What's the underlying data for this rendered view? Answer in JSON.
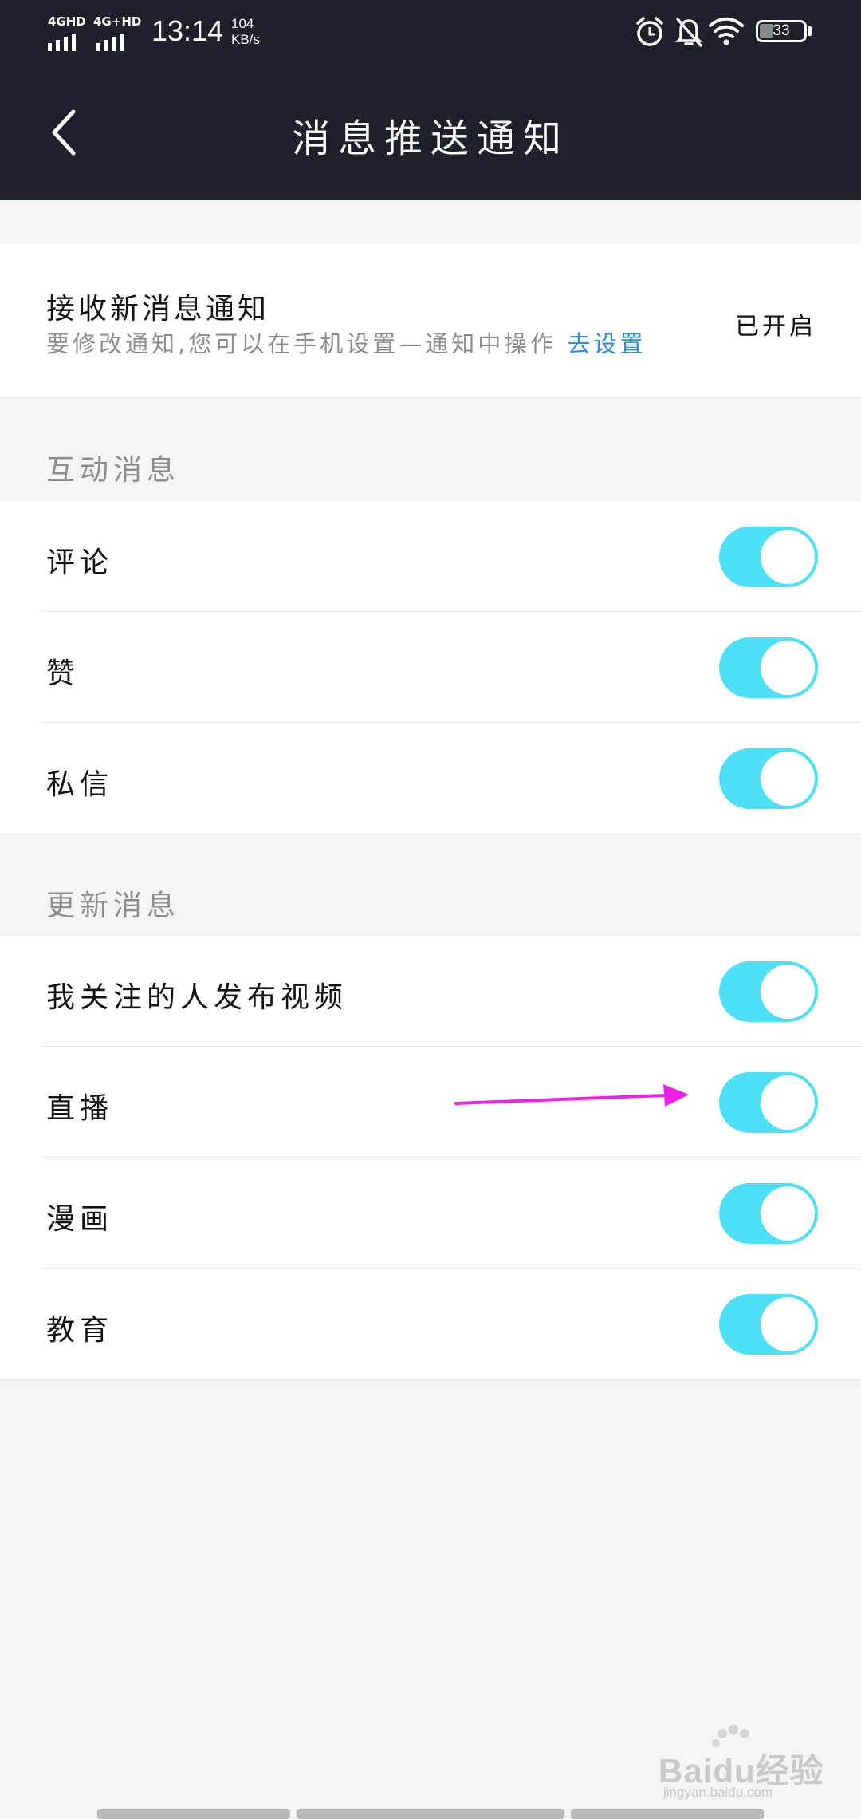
{
  "status_bar": {
    "signal1": "4GHD",
    "signal2": "4G+HD",
    "time": "13:14",
    "speed_value": "104",
    "speed_unit": "KB/s",
    "battery": "33",
    "icons": [
      "alarm-icon",
      "mute-bell-icon",
      "wifi-icon",
      "battery-icon"
    ]
  },
  "header": {
    "title": "消息推送通知",
    "back_icon": "back-arrow-icon"
  },
  "notify": {
    "title": "接收新消息通知",
    "subtitle": "要修改通知,您可以在手机设置—通知中操作",
    "link": "去设置",
    "status": "已开启"
  },
  "sections": [
    {
      "title": "互动消息",
      "items": [
        {
          "label": "评论",
          "enabled": true
        },
        {
          "label": "赞",
          "enabled": true
        },
        {
          "label": "私信",
          "enabled": true
        }
      ]
    },
    {
      "title": "更新消息",
      "items": [
        {
          "label": "我关注的人发布视频",
          "enabled": true
        },
        {
          "label": "直播",
          "enabled": true
        },
        {
          "label": "漫画",
          "enabled": true
        },
        {
          "label": "教育",
          "enabled": true
        }
      ]
    }
  ],
  "colors": {
    "topbar": "#1c212b",
    "toggle_on": "#4ee0f6",
    "link": "#2d8cf0",
    "annotation_arrow": "#f020e8"
  },
  "watermark": {
    "brand": "Baidu经验",
    "url": "jingyan.baidu.com"
  }
}
